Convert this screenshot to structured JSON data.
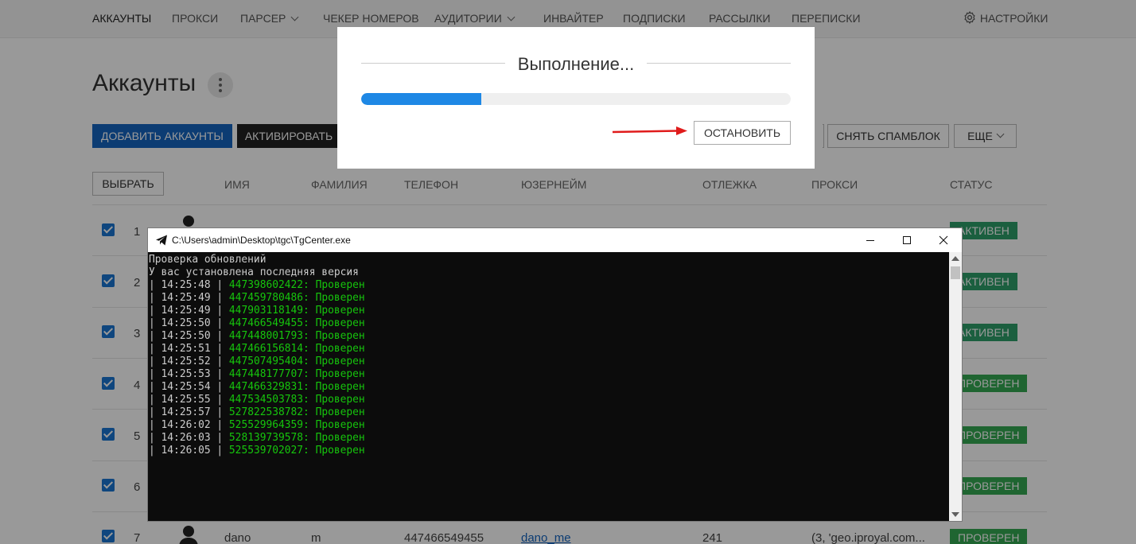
{
  "nav": {
    "items": [
      "Аккаунты",
      "Прокси",
      "Парсер",
      "Чекер номеров",
      "Аудитории",
      "Инвайтер",
      "Подписки",
      "Рассылки",
      "Переписки"
    ],
    "settings_label": "Настройки",
    "gear_icon": "gear-icon",
    "active_index": 0
  },
  "page": {
    "title": "Аккаунты",
    "toolbar": {
      "add_label": "Добавить аккаунты",
      "activate_label": "Активировать",
      "unspam_label": "Снять спамблок",
      "more_label": "Еще"
    },
    "select_label": "Выбрать",
    "columns": [
      "Имя",
      "Фамилия",
      "Телефон",
      "Юзернейм",
      "Отлежка",
      "Прокси",
      "Статус"
    ],
    "rows": [
      {
        "num": "1",
        "status": "Активен"
      },
      {
        "num": "2",
        "status": "Активен"
      },
      {
        "num": "3",
        "status": "Активен"
      },
      {
        "num": "4",
        "status": "Проверен"
      },
      {
        "num": "5",
        "status": "Проверен"
      },
      {
        "num": "6",
        "status": "Проверен"
      },
      {
        "num": "7",
        "status": "Проверен",
        "first_name": "dano",
        "last_name": "m",
        "phone": "447466549455",
        "username": "dano_me",
        "age": "241",
        "proxy": "(3, 'geo.iproyal.com..."
      }
    ],
    "colors": {
      "primary": "#1565c0",
      "active_badge": "#2e9e6a",
      "checked_badge": "#34a853"
    }
  },
  "modal": {
    "title": "Выполнение...",
    "progress": 0.28,
    "stop_label": "Остановить",
    "accent": "#1e88e5"
  },
  "console": {
    "title": "C:\\Users\\admin\\Desktop\\tgc\\TgCenter.exe",
    "header_lines": [
      "Проверка обновлений",
      "У вас установлена последняя версия"
    ],
    "log": [
      {
        "time": "14:25:48",
        "msg": "447398602422: Проверен"
      },
      {
        "time": "14:25:49",
        "msg": "447459780486: Проверен"
      },
      {
        "time": "14:25:49",
        "msg": "447903118149: Проверен"
      },
      {
        "time": "14:25:50",
        "msg": "447466549455: Проверен"
      },
      {
        "time": "14:25:50",
        "msg": "447448001793: Проверен"
      },
      {
        "time": "14:25:51",
        "msg": "447466156814: Проверен"
      },
      {
        "time": "14:25:52",
        "msg": "447507495404: Проверен"
      },
      {
        "time": "14:25:53",
        "msg": "447448177707: Проверен"
      },
      {
        "time": "14:25:54",
        "msg": "447466329831: Проверен"
      },
      {
        "time": "14:25:55",
        "msg": "447534503783: Проверен"
      },
      {
        "time": "14:25:57",
        "msg": "527822538782: Проверен"
      },
      {
        "time": "14:26:02",
        "msg": "525529964359: Проверен"
      },
      {
        "time": "14:26:03",
        "msg": "528139739578: Проверен"
      },
      {
        "time": "14:26:05",
        "msg": "525539702027: Проверен"
      }
    ],
    "success_color": "#16c60c"
  }
}
